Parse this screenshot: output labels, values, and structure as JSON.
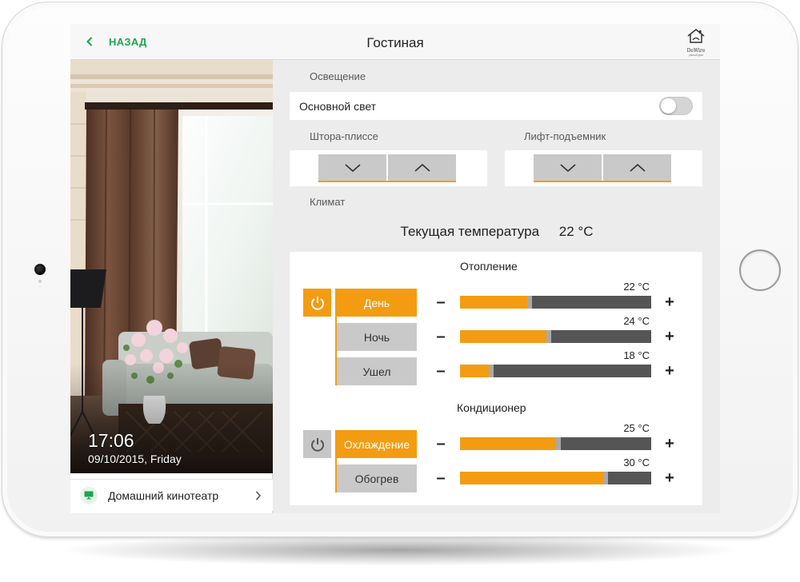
{
  "header": {
    "back_label": "НАЗАД",
    "title": "Гостиная",
    "logo_text": "DeWire",
    "logo_sub": "умный дом"
  },
  "left": {
    "time": "17:06",
    "date": "09/10/2015, Friday",
    "scene_label": "Домашний кинотеатр"
  },
  "lighting": {
    "section": "Освещение",
    "main_light_label": "Основной свет",
    "main_light_on": false
  },
  "blinds": {
    "pleated_label": "Штора-плиссе",
    "lift_label": "Лифт-подъемник"
  },
  "climate": {
    "section": "Климат",
    "current_label": "Текущая температура",
    "current_value": "22 °C",
    "heating": {
      "title": "Отопление",
      "power": true,
      "modes": [
        {
          "label": "День",
          "active": true,
          "setpoint": "22 °C",
          "level": 0.35
        },
        {
          "label": "Ночь",
          "active": false,
          "setpoint": "24 °C",
          "level": 0.45
        },
        {
          "label": "Ушел",
          "active": false,
          "setpoint": "18 °C",
          "level": 0.15
        }
      ]
    },
    "cooling": {
      "title": "Кондиционер",
      "power": false,
      "modes": [
        {
          "label": "Охлаждение",
          "active": true,
          "setpoint": "25 °C",
          "level": 0.5
        },
        {
          "label": "Обогрев",
          "active": false,
          "setpoint": "30 °C",
          "level": 0.75
        }
      ]
    }
  },
  "colors": {
    "accent": "#f39c12",
    "brand_green": "#1aa650",
    "track": "#555555",
    "button_gray": "#c9c9c9"
  },
  "icons": {
    "back": "chevron-left-icon",
    "scene": "tv-icon",
    "scene_arrow": "chevron-right-icon",
    "power": "power-icon",
    "down": "chevron-down-icon",
    "up": "chevron-up-icon",
    "logo": "house-icon"
  }
}
